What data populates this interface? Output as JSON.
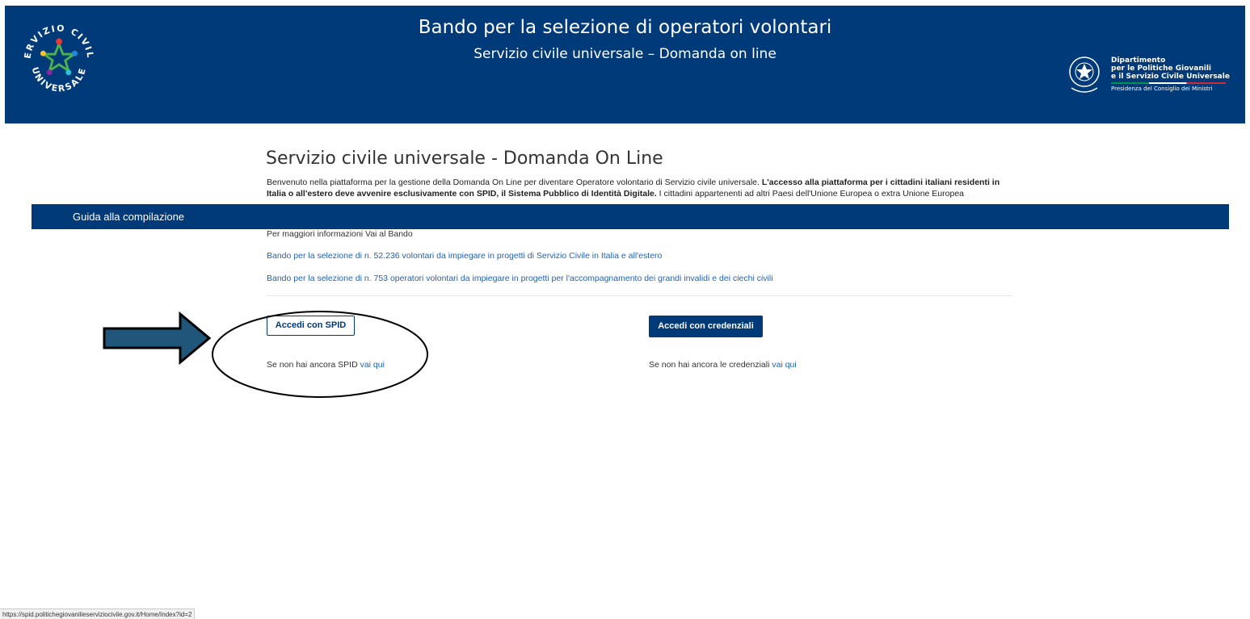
{
  "header": {
    "title": "Bando per la selezione di operatori volontari",
    "subtitle": "Servizio civile universale – Domanda on line",
    "logo_text_top": "SERVIZIO CIVILE",
    "logo_text_bottom": "UNIVERSALE",
    "dept_line1": "Dipartimento",
    "dept_line2": "per le Politiche Giovanili",
    "dept_line3": "e il Servizio Civile Universale",
    "dept_line4": "Presidenza del Consiglio dei Ministri",
    "colors": {
      "brand": "#003a78"
    }
  },
  "main": {
    "title": "Servizio civile universale - Domanda On Line",
    "intro_part1": "Benvenuto nella piattaforma per la gestione della Domanda On Line per diventare Operatore volontario di Servizio civile universale. ",
    "intro_bold": "L'accesso alla piattaforma per i cittadini italiani residenti in Italia o all'estero deve avvenire esclusivamente con SPID, il Sistema Pubblico di Identità Digitale.",
    "intro_part2": " I cittadini appartenenti ad altri Paesi dell'Unione Europea o extra Unione Europea",
    "more_info": "Per maggiori informazioni Vai al Bando",
    "link1": "Bando per la selezione di n. 52.236 volontari da impiegare in progetti di Servizio Civile in Italia e all'estero",
    "link2": "Bando per la selezione di n. 753 operatori volontari da impiegare in progetti per l'accompagnamento dei grandi invalidi e dei ciechi civili"
  },
  "guide_bar": {
    "label": "Guida alla compilazione"
  },
  "login": {
    "spid_button": "Accedi con SPID",
    "spid_hint": "Se non hai ancora SPID ",
    "spid_hint_link": "vai qui",
    "cred_button": "Accedi con credenziali",
    "cred_hint": "Se non hai ancora le credenziali ",
    "cred_hint_link": "vai qui"
  },
  "statusbar": {
    "url": "https://spid.politichegiovanilieserviziocivile.gov.it/Home/Index?id=2"
  }
}
